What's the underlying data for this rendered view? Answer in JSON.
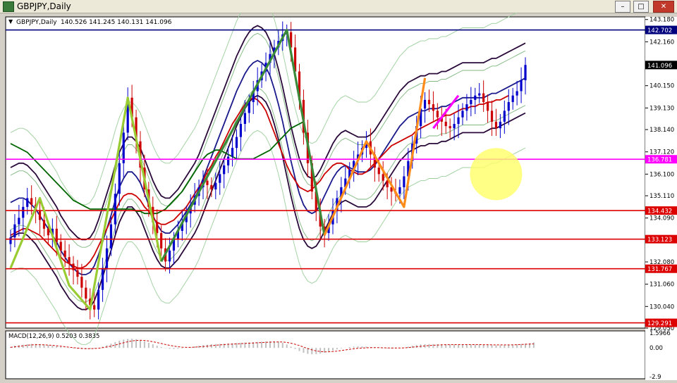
{
  "window": {
    "title": "GBPJPY,Daily",
    "buttons": [
      "minimize-button",
      "maximize-button",
      "close-button"
    ]
  },
  "chart_data": [
    {
      "type": "candlestick",
      "symbol_label": "GBPJPY,Daily",
      "ohlc_label": "140.526 141.245 140.131 141.096",
      "ylim": [
        129.05,
        143.3
      ],
      "y_tick_labels": [
        "143.180",
        "142.160",
        "141.130",
        "140.150",
        "139.130",
        "138.140",
        "137.120",
        "136.100",
        "135.110",
        "134.090",
        "133.070",
        "132.080",
        "131.060",
        "130.040",
        "129.050"
      ],
      "last_price": "141.096",
      "horizontal_lines": [
        {
          "value": 142.702,
          "label": "142.702",
          "color": "#00007f"
        },
        {
          "value": 136.781,
          "label": "136.781",
          "color": "#ff00ff"
        },
        {
          "value": 134.432,
          "label": "134.432",
          "color": "#dd0000"
        },
        {
          "value": 133.123,
          "label": "133.123",
          "color": "#dd0000"
        },
        {
          "value": 131.767,
          "label": "131.767",
          "color": "#dd0000"
        },
        {
          "value": 129.291,
          "label": "129.291",
          "color": "#dd0000"
        }
      ],
      "closes": [
        133.2,
        133.8,
        134.1,
        134.6,
        135.0,
        134.7,
        134.4,
        134.0,
        133.6,
        133.3,
        133.6,
        133.0,
        132.6,
        132.3,
        132.0,
        131.7,
        131.4,
        130.9,
        130.4,
        130.1,
        129.9,
        130.8,
        131.8,
        132.7,
        133.8,
        135.2,
        136.6,
        138.0,
        139.6,
        138.7,
        137.6,
        136.4,
        135.4,
        134.6,
        133.9,
        133.4,
        132.7,
        132.1,
        132.6,
        133.1,
        133.5,
        133.9,
        134.3,
        134.7,
        135.1,
        135.5,
        135.8,
        135.6,
        135.4,
        135.7,
        136.1,
        136.5,
        136.9,
        137.3,
        137.8,
        138.4,
        138.9,
        139.4,
        139.9,
        140.4,
        140.8,
        141.2,
        141.6,
        141.9,
        142.2,
        142.5,
        142.6,
        141.9,
        140.8,
        139.5,
        138.0,
        136.6,
        135.3,
        134.4,
        133.7,
        133.4,
        133.8,
        134.4,
        135.0,
        135.5,
        135.9,
        136.3,
        136.7,
        137.0,
        137.3,
        137.6,
        137.0,
        136.4,
        136.1,
        135.8,
        135.5,
        135.3,
        135.2,
        135.5,
        136.0,
        136.7,
        137.5,
        138.3,
        139.1,
        139.5,
        139.3,
        139.0,
        138.7,
        138.5,
        138.3,
        138.2,
        138.4,
        138.7,
        139.0,
        139.3,
        139.5,
        139.7,
        139.8,
        139.4,
        139.0,
        138.5,
        138.2,
        138.5,
        139.0,
        139.4,
        139.7,
        139.9,
        140.4,
        141.1
      ],
      "series": [
        {
          "name": "",
          "color": "#1a1a8c",
          "values": [
            134.8,
            134.9,
            135.0,
            135.0,
            134.9,
            134.7,
            134.5,
            134.2,
            133.9,
            133.6,
            133.3,
            133.0,
            132.6,
            132.3,
            132.0,
            131.8,
            131.6,
            131.5,
            131.5,
            131.6,
            131.9,
            132.4,
            133.0,
            133.6,
            134.2,
            134.9,
            135.5,
            135.9,
            136.2,
            136.2,
            136.0,
            135.7,
            135.2,
            134.7,
            134.2,
            133.8,
            133.5,
            133.4,
            133.4,
            133.6,
            133.8,
            134.1,
            134.4,
            134.7,
            135.0,
            135.4,
            135.9,
            136.4,
            136.9,
            137.4,
            137.9,
            138.4,
            138.9,
            139.4,
            139.9,
            140.3,
            140.7,
            141.0,
            141.2,
            141.3,
            141.2,
            141.0,
            140.6,
            140.0,
            139.3,
            138.5,
            137.6,
            136.7,
            135.9,
            135.2,
            134.7,
            134.4,
            134.3,
            134.4,
            134.7,
            135.1,
            135.5,
            135.9,
            136.2,
            136.4,
            136.5,
            136.4,
            136.3,
            136.2,
            136.2,
            136.2,
            136.3,
            136.5,
            136.8,
            137.1,
            137.4,
            137.7,
            138.0,
            138.3,
            138.5,
            138.7,
            138.8,
            138.9,
            139.0,
            139.0,
            139.1,
            139.1,
            139.1,
            139.2,
            139.2,
            139.3,
            139.4,
            139.5,
            139.6,
            139.6,
            139.6,
            139.6,
            139.6,
            139.6,
            139.7,
            139.8,
            139.8,
            139.9,
            140.0,
            140.1,
            140.2,
            140.3,
            140.4,
            140.5
          ]
        },
        {
          "name": "",
          "color": "#cc0000",
          "values": [
            133.3,
            133.4,
            133.5,
            133.6,
            133.6,
            133.5,
            133.4,
            133.3,
            133.1,
            132.9,
            132.7,
            132.5,
            132.3,
            132.1,
            132.0,
            131.9,
            131.8,
            131.8,
            131.9,
            132.1,
            132.4,
            132.8,
            133.2,
            133.6,
            134.0,
            134.4,
            134.8,
            135.1,
            135.2,
            135.2,
            135.1,
            134.9,
            134.6,
            134.4,
            134.1,
            133.9,
            133.8,
            133.8,
            133.9,
            134.0,
            134.2,
            134.4,
            134.6,
            134.9,
            135.2,
            135.5,
            135.8,
            136.2,
            136.5,
            136.9,
            137.2,
            137.6,
            138.0,
            138.4,
            138.7,
            139.0,
            139.3,
            139.5,
            139.6,
            139.5,
            139.3,
            139.0,
            138.5,
            138.0,
            137.5,
            137.0,
            136.5,
            136.1,
            135.8,
            135.5,
            135.4,
            135.3,
            135.4,
            135.6,
            135.8,
            136.1,
            136.3,
            136.5,
            136.6,
            136.6,
            136.5,
            136.3,
            136.2,
            136.1,
            136.1,
            136.2,
            136.4,
            136.6,
            136.8,
            137.0,
            137.2,
            137.4,
            137.5,
            137.6,
            137.7,
            137.8,
            137.9,
            138.1,
            138.2,
            138.3,
            138.4,
            138.5,
            138.6,
            138.7,
            138.8,
            138.8,
            138.9,
            139.0,
            139.1,
            139.1,
            139.2,
            139.2,
            139.3,
            139.3,
            139.4,
            139.4,
            139.5,
            139.5,
            139.6,
            139.7
          ]
        },
        {
          "name": "",
          "color": "#006600",
          "values": [
            137.5,
            137.4,
            137.3,
            137.2,
            137.1,
            136.9,
            136.7,
            136.5,
            136.3,
            136.1,
            135.9,
            135.7,
            135.5,
            135.3,
            135.1,
            134.9,
            134.8,
            134.7,
            134.6,
            134.5,
            134.5,
            134.5,
            134.5,
            134.5,
            134.5,
            134.5,
            134.5,
            134.5,
            134.5,
            134.5,
            134.4,
            134.4,
            134.3,
            134.3,
            134.3,
            134.3,
            134.4,
            134.5,
            134.7,
            134.9,
            135.1,
            135.3,
            135.6,
            135.9,
            136.2,
            136.5,
            136.8,
            137.0,
            137.1,
            137.2,
            137.2,
            137.1,
            137.0,
            136.9,
            136.8,
            136.8,
            136.8,
            136.8,
            136.8,
            136.9,
            137.0,
            137.1,
            137.2,
            137.4,
            137.6,
            137.8,
            138.0,
            138.2,
            138.3,
            138.4,
            138.5
          ]
        },
        {
          "name": "",
          "color": "#330033",
          "values": [
            129.5,
            129.7,
            130.0,
            130.4,
            130.7,
            130.9,
            131.0,
            130.9,
            130.7,
            130.4,
            130.1,
            129.8,
            129.6,
            129.5,
            129.5,
            129.6,
            129.8,
            130.1,
            130.5,
            131.0,
            131.6,
            132.1,
            132.5,
            132.7,
            132.7,
            132.6,
            132.4,
            132.2,
            132.0,
            131.9,
            131.9,
            132.0,
            132.2,
            132.5,
            132.8,
            133.0,
            133.2,
            133.4,
            133.6,
            133.9,
            134.2,
            134.5,
            134.8,
            135.1,
            135.4,
            135.8,
            136.2,
            136.6,
            137.0,
            137.4,
            137.8,
            138.1,
            138.4,
            138.6,
            138.7,
            138.7,
            138.6,
            138.3,
            137.9,
            137.3,
            136.7,
            136.0,
            135.3,
            134.6,
            134.0,
            133.5,
            133.2,
            133.1,
            133.2,
            133.4,
            133.7,
            134.0,
            134.2,
            134.4,
            134.6,
            134.7,
            134.7,
            134.6,
            134.5,
            134.5,
            134.6,
            134.8,
            135.1,
            135.4,
            135.7,
            136.0,
            136.3,
            136.6,
            136.8,
            137.0,
            137.1,
            137.2,
            137.2,
            137.1,
            137.1,
            137.2,
            137.3,
            137.3,
            137.4,
            137.5,
            137.6,
            137.7,
            137.7,
            137.8,
            137.8,
            137.9,
            137.9,
            137.9,
            138.0,
            138.0,
            138.0,
            138.0,
            138.0,
            138.0,
            138.0,
            138.0,
            138.0,
            138.0,
            138.0,
            138.0,
            138.0,
            138.0,
            138.0,
            138.0,
            138.0,
            138.0,
            138.0,
            138.0,
            138.0,
            138.0
          ]
        }
      ],
      "zigzag": [
        {
          "color": "#99cc33",
          "points": [
            [
              0,
              131.8
            ],
            [
              7,
              135.0
            ],
            [
              14,
              131.0
            ],
            [
              19,
              129.9
            ],
            [
              28,
              139.6
            ],
            [
              36,
              132.1
            ]
          ]
        },
        {
          "color": "#3a8a3a",
          "points": [
            [
              36,
              132.1
            ],
            [
              66,
              142.7
            ],
            [
              75,
              133.3
            ]
          ]
        },
        {
          "color": "#ff8c1a",
          "points": [
            [
              75,
              133.3
            ],
            [
              85,
              137.6
            ],
            [
              94,
              134.6
            ],
            [
              99,
              140.5
            ]
          ]
        },
        {
          "color": "#ff00ff",
          "points": [
            [
              101,
              138.2
            ],
            [
              107,
              139.7
            ]
          ]
        }
      ],
      "highlight_circle": {
        "value": 136.1,
        "x_index": 116,
        "color": "#ffff66"
      }
    },
    {
      "type": "histogram",
      "label": "MACD(12,26,9) 0.5203 0.3835",
      "y_tick_labels": [
        "1.5966",
        "0.00",
        "-2.9"
      ],
      "ylim": [
        -2.9,
        1.5966
      ],
      "series": [
        {
          "name": "",
          "color": "#c0c0c0",
          "values": [
            0.1,
            0.2,
            0.25,
            0.3,
            0.35,
            0.38,
            0.38,
            0.36,
            0.32,
            0.28,
            0.22,
            0.16,
            0.1,
            0.04,
            -0.02,
            -0.06,
            -0.1,
            -0.12,
            -0.12,
            -0.1,
            -0.06,
            0.02,
            0.12,
            0.25,
            0.4,
            0.55,
            0.68,
            0.78,
            0.84,
            0.86,
            0.82,
            0.74,
            0.62,
            0.48,
            0.34,
            0.2,
            0.08,
            -0.02,
            -0.08,
            -0.1,
            -0.08,
            -0.04,
            0.02,
            0.08,
            0.14,
            0.2,
            0.26,
            0.3,
            0.34,
            0.36,
            0.38,
            0.4,
            0.42,
            0.44,
            0.46,
            0.48,
            0.5,
            0.52,
            0.54,
            0.56,
            0.58,
            0.6,
            0.62,
            0.62,
            0.58,
            0.48,
            0.32,
            0.12,
            -0.1,
            -0.3,
            -0.46,
            -0.56,
            -0.6,
            -0.58,
            -0.52,
            -0.44,
            -0.34,
            -0.24,
            -0.14,
            -0.05,
            0.02,
            0.08,
            0.12,
            0.14,
            0.14,
            0.12,
            0.08,
            0.04,
            0.0,
            -0.03,
            -0.05,
            -0.06,
            -0.05,
            -0.02,
            0.04,
            0.12,
            0.2,
            0.27,
            0.32,
            0.35,
            0.36,
            0.36,
            0.35,
            0.34,
            0.33,
            0.32,
            0.31,
            0.3,
            0.3,
            0.3,
            0.3,
            0.3,
            0.3,
            0.29,
            0.28,
            0.26,
            0.24,
            0.24,
            0.25,
            0.27,
            0.3,
            0.33,
            0.36,
            0.4,
            0.44,
            0.52
          ]
        },
        {
          "name": "",
          "color": "#cc0000",
          "values": [
            0.05,
            0.1,
            0.15,
            0.2,
            0.25,
            0.28,
            0.3,
            0.3,
            0.29,
            0.27,
            0.24,
            0.2,
            0.16,
            0.11,
            0.06,
            0.02,
            -0.02,
            -0.05,
            -0.07,
            -0.07,
            -0.06,
            -0.03,
            0.02,
            0.09,
            0.17,
            0.27,
            0.38,
            0.48,
            0.58,
            0.65,
            0.7,
            0.72,
            0.7,
            0.65,
            0.58,
            0.5,
            0.41,
            0.32,
            0.24,
            0.17,
            0.11,
            0.07,
            0.05,
            0.05,
            0.07,
            0.1,
            0.13,
            0.17,
            0.21,
            0.25,
            0.28,
            0.31,
            0.34,
            0.36,
            0.38,
            0.4,
            0.42,
            0.44,
            0.46,
            0.48,
            0.5,
            0.52,
            0.54,
            0.56,
            0.56,
            0.55,
            0.51,
            0.44,
            0.34,
            0.22,
            0.08,
            -0.06,
            -0.18,
            -0.28,
            -0.34,
            -0.37,
            -0.37,
            -0.34,
            -0.3,
            -0.25,
            -0.19,
            -0.13,
            -0.08,
            -0.04,
            -0.01,
            0.01,
            0.02,
            0.02,
            0.02,
            0.01,
            0.0,
            -0.01,
            -0.01,
            -0.01,
            0.0,
            0.03,
            0.07,
            0.11,
            0.15,
            0.19,
            0.22,
            0.25,
            0.27,
            0.29,
            0.3,
            0.3,
            0.31,
            0.31,
            0.31,
            0.31,
            0.31,
            0.31,
            0.31,
            0.3,
            0.3,
            0.29,
            0.28,
            0.28,
            0.28,
            0.28,
            0.29,
            0.3,
            0.32,
            0.34,
            0.36,
            0.38
          ]
        }
      ]
    }
  ]
}
